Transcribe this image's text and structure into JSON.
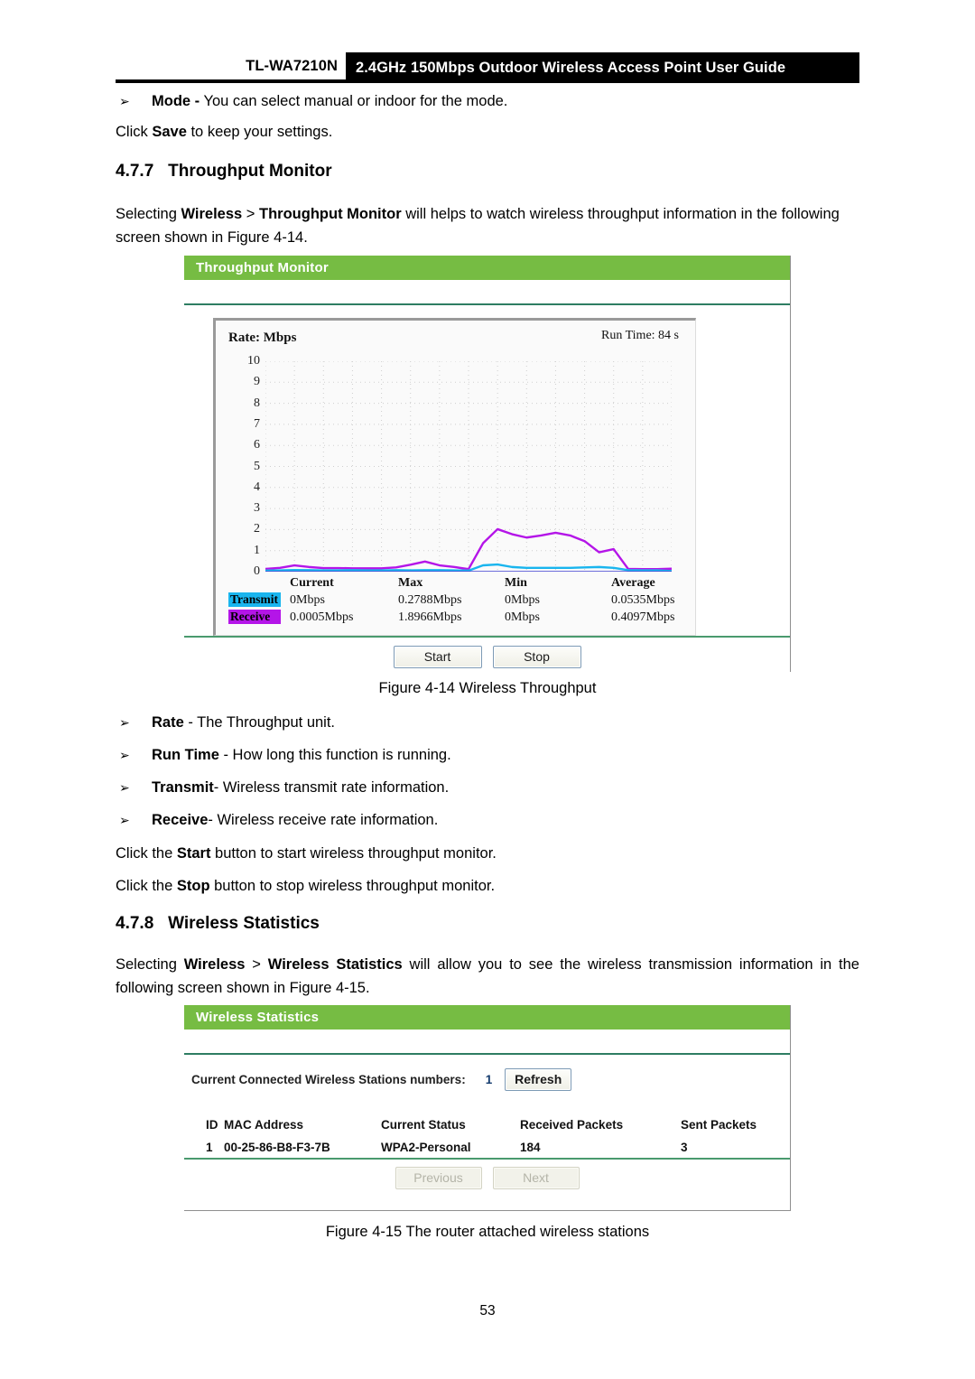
{
  "header": {
    "model": "TL-WA7210N",
    "title": "2.4GHz 150Mbps Outdoor Wireless Access Point User Guide"
  },
  "intro": {
    "mode_bullet_mark": "➢",
    "mode_bold": "Mode -",
    "mode_rest": " You can select manual or indoor for the mode.",
    "save_pre": "Click ",
    "save_bold": "Save",
    "save_post": " to keep your settings."
  },
  "section_477": {
    "number": "4.7.7",
    "title": "Throughput Monitor",
    "para_pre": "Selecting ",
    "para_b1": "Wireless",
    "para_mid": " > ",
    "para_b2": "Throughput Monitor",
    "para_post": " will helps to watch wireless throughput information in the following screen shown in Figure 4-14."
  },
  "throughput_panel": {
    "title": "Throughput Monitor",
    "rate_label": "Rate: Mbps",
    "run_time_label": "Run Time: 84 s",
    "stats_headers": [
      "",
      "Current",
      "Max",
      "Min",
      "Average"
    ],
    "rows": [
      {
        "name": "Transmit",
        "color": "#19b5ee",
        "current": "0Mbps",
        "max": "0.2788Mbps",
        "min": "0Mbps",
        "average": "0.0535Mbps"
      },
      {
        "name": "Receive",
        "color": "#b415e8",
        "current": "0.0005Mbps",
        "max": "1.8966Mbps",
        "min": "0Mbps",
        "average": "0.4097Mbps"
      }
    ],
    "start_label": "Start",
    "stop_label": "Stop"
  },
  "chart_data": {
    "type": "line",
    "title": "Rate: Mbps",
    "annotation": "Run Time: 84 s",
    "xlabel": "",
    "ylabel": "Rate (Mbps)",
    "ylim": [
      0,
      10
    ],
    "yticks": [
      10,
      9,
      8,
      7,
      6,
      5,
      4,
      3,
      2,
      1,
      0
    ],
    "grid": true,
    "legend_position": "below-plot",
    "x": [
      0,
      1,
      2,
      3,
      4,
      5,
      6,
      7,
      8,
      9,
      10,
      11,
      12,
      13,
      14,
      15,
      16,
      17,
      18,
      19,
      20,
      21,
      22,
      23,
      24,
      25,
      26,
      27,
      28
    ],
    "series": [
      {
        "name": "Transmit",
        "color": "#19b5ee",
        "values": [
          0.05,
          0.06,
          0.08,
          0.07,
          0.06,
          0.06,
          0.07,
          0.06,
          0.06,
          0.07,
          0.06,
          0.07,
          0.07,
          0.06,
          0.05,
          0.3,
          0.34,
          0.22,
          0.18,
          0.18,
          0.18,
          0.18,
          0.2,
          0.22,
          0.18,
          0.07,
          0.06,
          0.06,
          0.03
        ],
        "current": "0Mbps",
        "max": "0.2788Mbps",
        "min": "0Mbps",
        "average": "0.0535Mbps"
      },
      {
        "name": "Receive",
        "color": "#b415e8",
        "values": [
          0.13,
          0.18,
          0.3,
          0.22,
          0.17,
          0.17,
          0.16,
          0.16,
          0.16,
          0.2,
          0.33,
          0.48,
          0.3,
          0.22,
          0.12,
          1.35,
          2.02,
          1.78,
          1.62,
          1.72,
          1.85,
          1.72,
          1.45,
          0.92,
          1.07,
          0.13,
          0.12,
          0.12,
          0.14
        ],
        "current": "0.0005Mbps",
        "max": "1.8966Mbps",
        "min": "0Mbps",
        "average": "0.4097Mbps"
      }
    ]
  },
  "figure_414": "Figure 4-14 Wireless Throughput",
  "bullets_414": [
    {
      "mark": "➢",
      "bold": "Rate",
      "rest": " - The Throughput unit."
    },
    {
      "mark": "➢",
      "bold": "Run Time",
      "rest": " - How long this function is running."
    },
    {
      "mark": "➢",
      "bold": "Transmit",
      "rest": "- Wireless transmit rate information."
    },
    {
      "mark": "➢",
      "bold": "Receive",
      "rest": "- Wireless receive rate information."
    }
  ],
  "start_stop_notes": [
    {
      "pre": "Click the ",
      "bold": "Start",
      "post": " button to start wireless throughput monitor."
    },
    {
      "pre": "Click the ",
      "bold": "Stop",
      "post": " button to stop wireless throughput monitor."
    }
  ],
  "section_478": {
    "number": "4.7.8",
    "title": "Wireless Statistics",
    "para_pre": "Selecting ",
    "para_b1": "Wireless",
    "para_mid": " > ",
    "para_b2": "Wireless Statistics",
    "para_post": " will allow you to see the wireless transmission information in the following screen shown in Figure 4-15."
  },
  "wstats_panel": {
    "title": "Wireless Statistics",
    "count_label": "Current Connected Wireless Stations numbers:",
    "count_value": "1",
    "refresh_label": "Refresh",
    "columns": [
      "ID",
      "MAC Address",
      "Current Status",
      "Received Packets",
      "Sent Packets"
    ],
    "rows": [
      {
        "id": "1",
        "mac": "00-25-86-B8-F3-7B",
        "status": "WPA2-Personal",
        "received": "184",
        "sent": "3"
      }
    ],
    "previous_label": "Previous",
    "next_label": "Next"
  },
  "figure_415": "Figure 4-15 The router attached wireless stations",
  "page_number": "53",
  "colors": {
    "panel_green": "#76bc43",
    "divider_green": "#2e7d62",
    "transmit": "#19b5ee",
    "receive": "#b415e8"
  }
}
